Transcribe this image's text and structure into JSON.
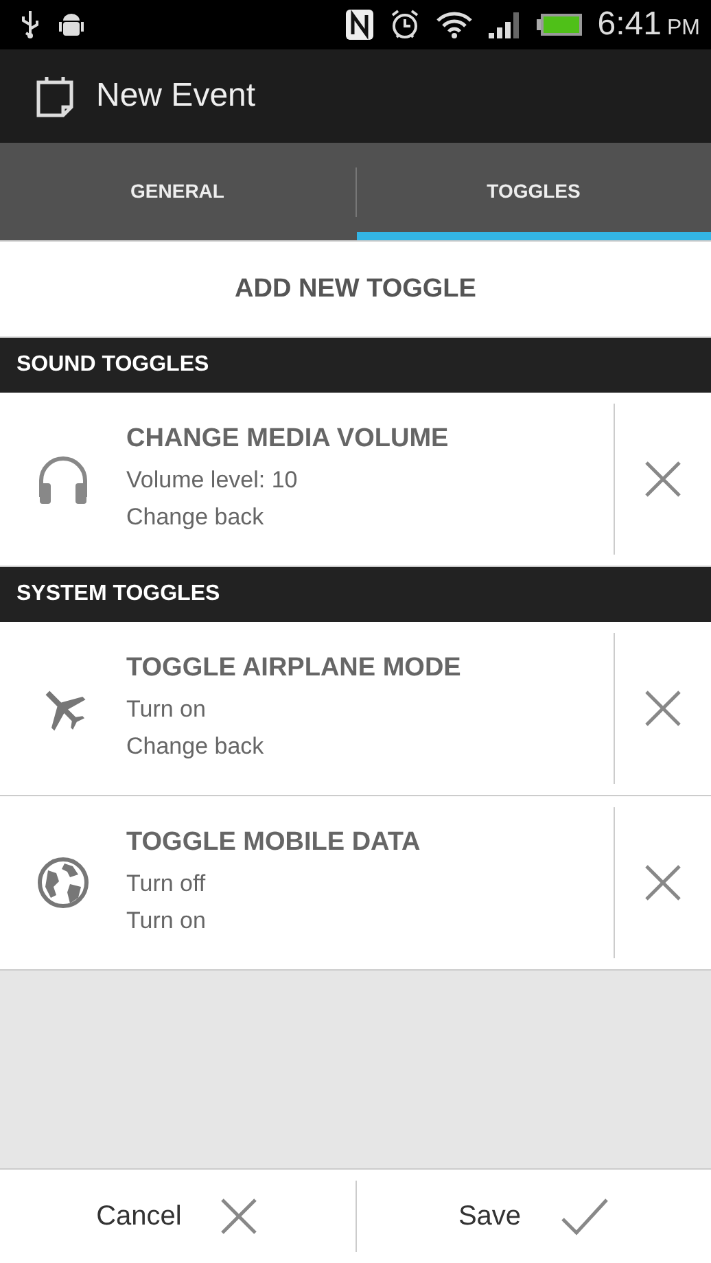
{
  "status_bar": {
    "time": "6:41",
    "ampm": "PM"
  },
  "action_bar": {
    "title": "New Event"
  },
  "tabs": [
    {
      "label": "GENERAL",
      "selected": false
    },
    {
      "label": "TOGGLES",
      "selected": true
    }
  ],
  "add_button": "ADD NEW TOGGLE",
  "sections": [
    {
      "title": "SOUND TOGGLES",
      "items": [
        {
          "kind": "volume",
          "title": "CHANGE MEDIA VOLUME",
          "lines": [
            "Volume level: 10",
            "Change back"
          ]
        }
      ]
    },
    {
      "title": "SYSTEM TOGGLES",
      "items": [
        {
          "kind": "airplane",
          "title": "TOGGLE AIRPLANE MODE",
          "lines": [
            "Turn on",
            "Change back"
          ]
        },
        {
          "kind": "data",
          "title": "TOGGLE MOBILE DATA",
          "lines": [
            "Turn off",
            "Turn on"
          ]
        }
      ]
    }
  ],
  "bottom_bar": [
    {
      "kind": "cancel",
      "label": "Cancel"
    },
    {
      "kind": "save",
      "label": "Save"
    }
  ]
}
